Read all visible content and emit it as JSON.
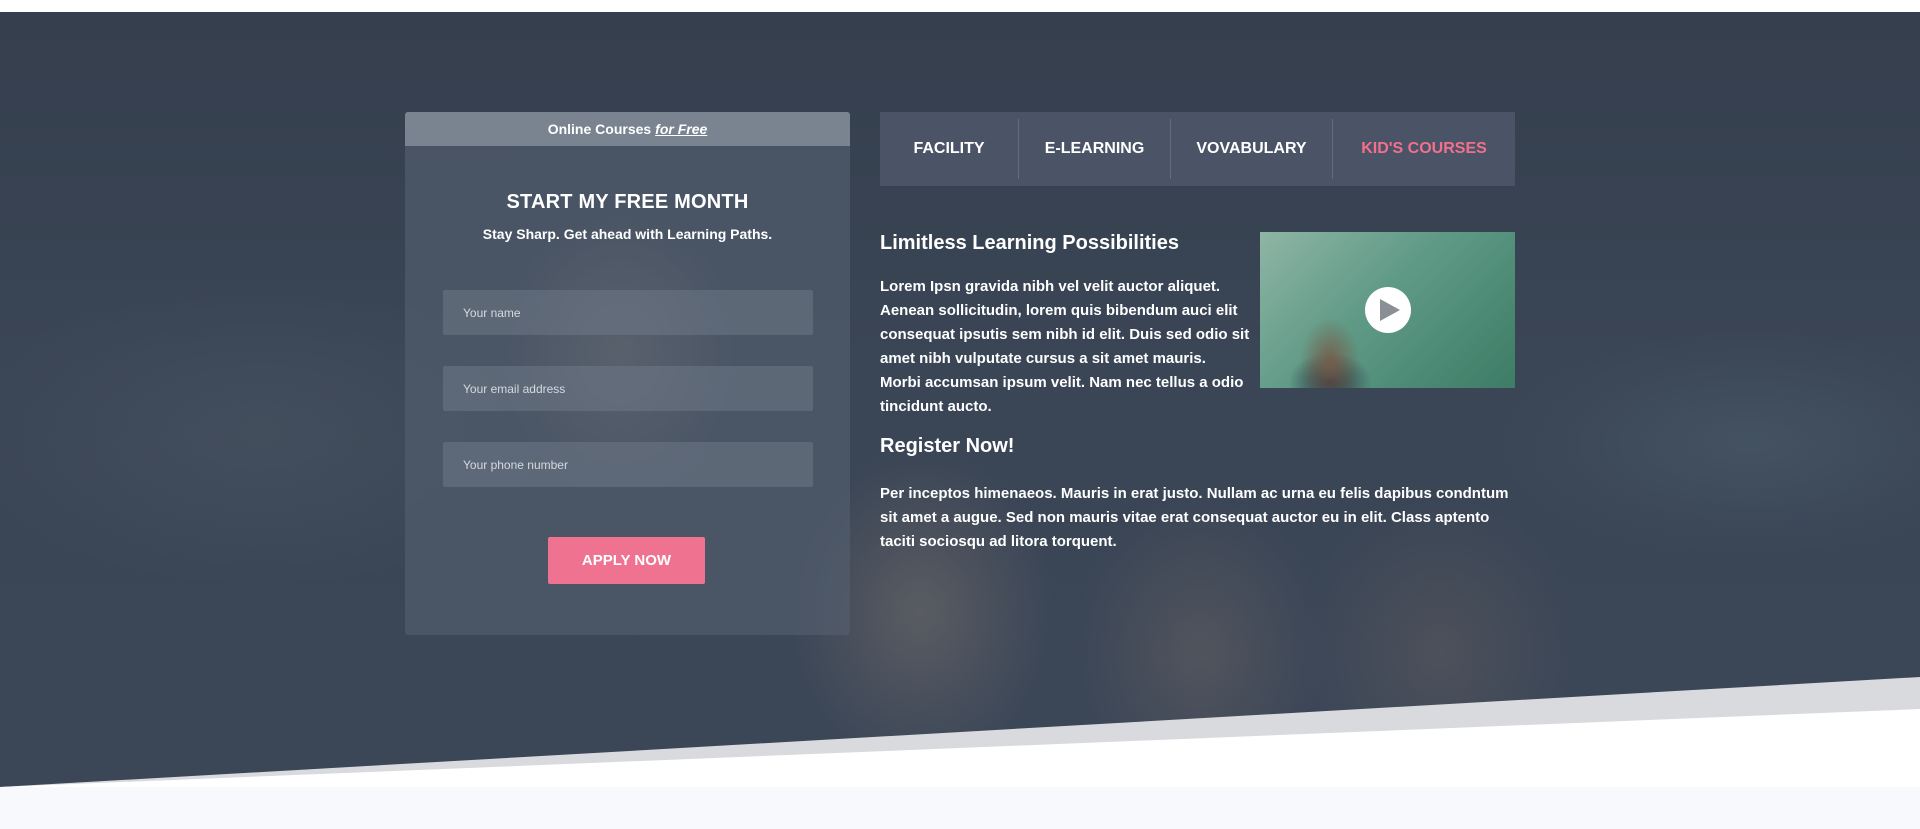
{
  "form": {
    "header_prefix": "Online Courses",
    "header_emphasis": "for Free",
    "title": "START MY FREE MONTH",
    "subtitle": "Stay Sharp. Get ahead with Learning Paths.",
    "name_placeholder": "Your name",
    "email_placeholder": "Your email address",
    "phone_placeholder": "Your phone number",
    "apply_label": "APPLY NOW"
  },
  "tabs": [
    {
      "label": "FACILITY",
      "active": false
    },
    {
      "label": "E-LEARNING",
      "active": false
    },
    {
      "label": "VOVABULARY",
      "active": false
    },
    {
      "label": "KID'S COURSES",
      "active": true
    }
  ],
  "content": {
    "section1_title": "Limitless Learning Possibilities",
    "section1_text": "Lorem Ipsn gravida nibh vel velit auctor aliquet. Aenean sollicitudin, lorem quis bibendum auci elit consequat ipsutis sem nibh id elit. Duis sed odio sit amet nibh vulputate cursus a sit amet mauris. Morbi accumsan ipsum velit. Nam nec tellus a odio tincidunt aucto.",
    "section2_title": "Register Now!",
    "section2_text": "Per inceptos himenaeos. Mauris in erat justo. Nullam ac urna eu felis dapibus condntum sit amet a augue. Sed non mauris vitae erat consequat auctor eu in elit. Class aptento taciti sociosqu ad litora torquent."
  },
  "video": {
    "icon": "play-icon"
  },
  "colors": {
    "accent": "#ef7390",
    "active_tab": "#f2708c",
    "hero_overlay": "#364252",
    "tab_bar": "#4b5466"
  }
}
